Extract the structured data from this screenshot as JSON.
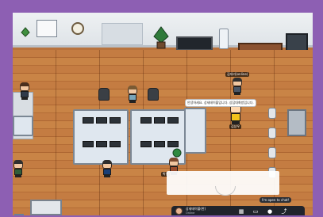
{
  "scene": {
    "speech_bubble": "안녕하세요. 상세테이블입니다. 상담대화방입니다.",
    "top_nametag": "김대리(online)",
    "center_nametag": "김상우",
    "lower_nametag": "박민"
  },
  "chat_overlay": {
    "open_to_chat": "I'm open to chat!"
  },
  "toolbar": {
    "user_name": "상세테이블(한)",
    "status": "Online",
    "icons": [
      "map-icon",
      "screen-icon",
      "camera-icon",
      "leave-icon"
    ]
  },
  "colors": {
    "frame": "#8d5fb3",
    "floor": "#c47c42",
    "toolbar": "#20242b"
  }
}
